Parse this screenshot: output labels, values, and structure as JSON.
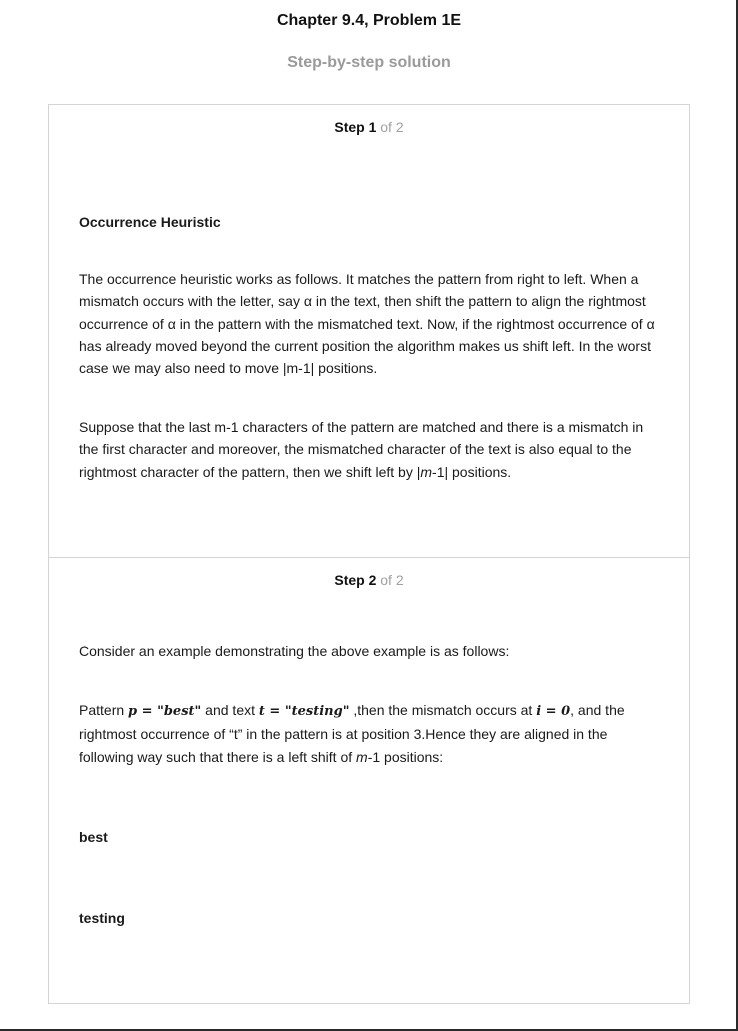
{
  "header": {
    "chapter_title": "Chapter 9.4, Problem 1E",
    "subtitle": "Step-by-step solution"
  },
  "step1": {
    "label": "Step 1",
    "of": "of 2",
    "heading": "Occurrence Heuristic",
    "para1": "The occurrence heuristic works as follows. It matches the pattern from right to left. When a mismatch occurs with the letter, say α in the text, then shift the pattern to align the rightmost occurrence of α in the pattern with the mismatched text. Now, if the rightmost occurrence of α has already moved beyond the current position the algorithm makes us shift left. In the worst case we may also need to move |m-1| positions.",
    "para2_a": "Suppose that the last m-1 characters of the pattern are matched and there is a mismatch in the first character and moreover, the mismatched character of the text is also equal to the rightmost character of the pattern, then we shift left by |",
    "para2_m": "m",
    "para2_b": "-1| positions."
  },
  "step2": {
    "label": "Step 2",
    "of": "of 2",
    "intro": "Consider an example demonstrating the above example is as follows:",
    "p_a": "Pattern ",
    "p_math1": "p = \"best\"",
    "p_b": " and text ",
    "p_math2": "t = \"testing\"",
    "p_c": " ,then the mismatch occurs at ",
    "p_math3": "i = 0",
    "p_d": ", and the rightmost occurrence of “t” in the pattern is at position 3.Hence they are aligned in the following way such that there is a left shift of ",
    "p_m": "m",
    "p_e": "-1 positions:",
    "word1": "best",
    "word2": "testing"
  }
}
